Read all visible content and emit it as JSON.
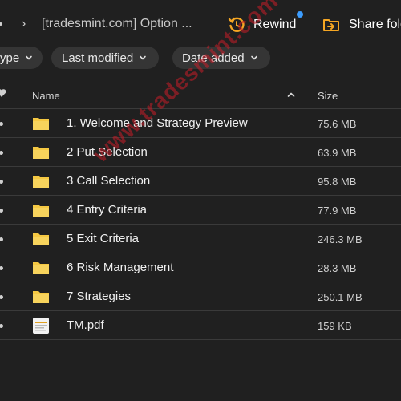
{
  "topbar": {
    "more_glyph": "••",
    "separator": "›",
    "folder_title": "[tradesmint.com] Option ...",
    "rewind_label": "Rewind",
    "share_label": "Share fold",
    "notification_color": "#3c9dff"
  },
  "filters": [
    {
      "label": "ype"
    },
    {
      "label": "Last modified"
    },
    {
      "label": "Date added"
    }
  ],
  "table": {
    "header_name": "Name",
    "header_size": "Size",
    "sort_direction": "ascending",
    "rows": [
      {
        "name": "1. Welcome and Strategy Preview",
        "size": "75.6 MB",
        "type": "folder"
      },
      {
        "name": "2 Put Selection",
        "size": "63.9 MB",
        "type": "folder"
      },
      {
        "name": "3 Call Selection",
        "size": "95.8 MB",
        "type": "folder"
      },
      {
        "name": "4 Entry Criteria",
        "size": "77.9 MB",
        "type": "folder"
      },
      {
        "name": "5 Exit Criteria",
        "size": "246.3 MB",
        "type": "folder"
      },
      {
        "name": "6 Risk Management",
        "size": "28.3 MB",
        "type": "folder"
      },
      {
        "name": "7 Strategies",
        "size": "250.1 MB",
        "type": "folder"
      },
      {
        "name": "TM.pdf",
        "size": "159 KB",
        "type": "pdf"
      }
    ]
  },
  "watermark": "www.tradesmint.com",
  "colors": {
    "background": "#202020",
    "folder": "#f5c842",
    "accent_orange": "#f5a623",
    "watermark": "#c81e28"
  }
}
